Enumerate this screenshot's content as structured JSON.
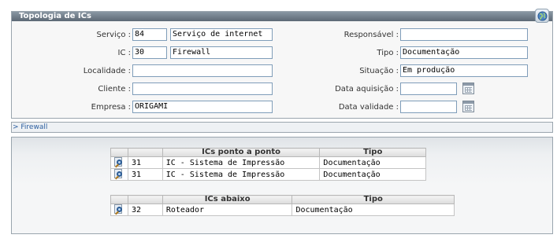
{
  "panel": {
    "title": "Topologia de ICs",
    "globe_icon": "globe-icon"
  },
  "form": {
    "servico": {
      "label": "Serviço :",
      "code": "84",
      "name": "Serviço de internet"
    },
    "ic": {
      "label": "IC :",
      "code": "30",
      "name": "Firewall"
    },
    "localidade": {
      "label": "Localidade :",
      "value": ""
    },
    "cliente": {
      "label": "Cliente :",
      "value": ""
    },
    "empresa": {
      "label": "Empresa :",
      "value": "ORIGAMI"
    },
    "responsavel": {
      "label": "Responsável :",
      "value": ""
    },
    "tipo": {
      "label": "Tipo :",
      "value": "Documentação"
    },
    "situacao": {
      "label": "Situação :",
      "value": "Em produção"
    },
    "data_aquisicao": {
      "label": "Data aquisição :",
      "value": ""
    },
    "data_validade": {
      "label": "Data validade :",
      "value": ""
    }
  },
  "breadcrumb": {
    "text": "> Firewall"
  },
  "tables": {
    "ponto_a_ponto": {
      "headers": [
        "",
        "",
        "ICs ponto a ponto",
        "Tipo"
      ],
      "rows": [
        {
          "id": "31",
          "name": "IC - Sistema de Impressão",
          "tipo": "Documentação"
        },
        {
          "id": "31",
          "name": "IC - Sistema de Impressão",
          "tipo": "Documentação"
        }
      ]
    },
    "abaixo": {
      "headers": [
        "",
        "",
        "ICs abaixo",
        "Tipo"
      ],
      "rows": [
        {
          "id": "32",
          "name": "Roteador",
          "tipo": "Documentação"
        }
      ]
    }
  },
  "colors": {
    "title_bar": "#6b7884",
    "border": "#9aa5ae",
    "input_border": "#7f9db9",
    "link": "#2a5d9f"
  }
}
